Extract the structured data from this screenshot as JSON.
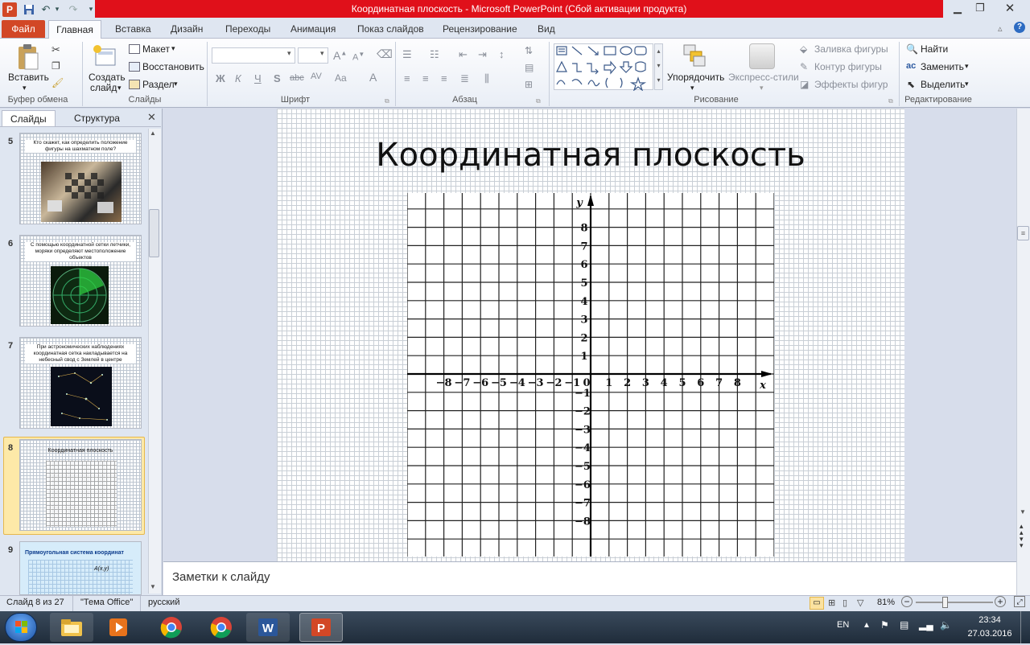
{
  "window": {
    "title": "Координатная плоскость  -  Microsoft PowerPoint (Сбой активации продукта)",
    "app_icon": "powerpoint-icon",
    "quick_access": [
      "save-icon",
      "undo-icon",
      "redo-icon",
      "customize-dropdown-icon"
    ]
  },
  "tabs": [
    "Файл",
    "Главная",
    "Вставка",
    "Дизайн",
    "Переходы",
    "Анимация",
    "Показ слайдов",
    "Рецензирование",
    "Вид"
  ],
  "ribbon": {
    "clipboard": {
      "label": "Буфер обмена",
      "paste": "Вставить"
    },
    "slides": {
      "label": "Слайды",
      "new_slide_line1": "Создать",
      "new_slide_line2": "слайд",
      "layout": "Макет",
      "reset": "Восстановить",
      "section": "Раздел"
    },
    "font": {
      "label": "Шрифт",
      "font_name": "",
      "font_size": "",
      "bold": "Ж",
      "italic": "К",
      "underline": "Ч",
      "shadow": "S",
      "strike": "abc",
      "spacing": "AV",
      "case": "Aa",
      "color": "A"
    },
    "paragraph": {
      "label": "Абзац"
    },
    "drawing": {
      "label": "Рисование",
      "arrange": "Упорядочить",
      "quick_styles": "Экспресс-стили",
      "fill": "Заливка фигуры",
      "outline": "Контур фигуры",
      "effects": "Эффекты фигур"
    },
    "editing": {
      "label": "Редактирование",
      "find": "Найти",
      "replace": "Заменить",
      "select": "Выделить"
    }
  },
  "panel": {
    "tab_slides": "Слайды",
    "tab_outline": "Структура",
    "thumbnails": [
      {
        "num": "5",
        "text": "Кто скажет, как определить положение фигуры на шахматном поле?"
      },
      {
        "num": "6",
        "text": "С помощью координатной сетки летчики, моряки определяют местоположение объектов"
      },
      {
        "num": "7",
        "text": "При астрономических наблюдениях координатная сетка накладывается на небесный свод с Землей в центре"
      },
      {
        "num": "8",
        "text": "Координатная плоскость"
      },
      {
        "num": "9",
        "text": "Прямоугольная система координат"
      }
    ],
    "thumb9_label": "A(x,y)"
  },
  "slide": {
    "title": "Координатная плоскость",
    "axis_x_label": "x",
    "axis_y_label": "y",
    "x_ticks": [
      "−8",
      "−7",
      "−6",
      "−5",
      "−4",
      "−3",
      "−2",
      "−1",
      "0",
      "1",
      "2",
      "3",
      "4",
      "5",
      "6",
      "7",
      "8"
    ],
    "y_ticks_pos": [
      "8",
      "7",
      "6",
      "5",
      "4",
      "3",
      "2",
      "1"
    ],
    "y_ticks_neg": [
      "−1",
      "−2",
      "−3",
      "−4",
      "−5",
      "−6",
      "−7",
      "−8"
    ]
  },
  "notes_placeholder": "Заметки к слайду",
  "status": {
    "slide_info": "Слайд 8 из 27",
    "theme": "\"Тема Office\"",
    "language": "русский",
    "zoom": "81%"
  },
  "taskbar": {
    "apps": [
      "start-button",
      "explorer-icon",
      "media-player-icon",
      "chrome-icon",
      "chrome-icon",
      "word-icon",
      "powerpoint-icon"
    ],
    "lang": "EN",
    "time": "23:34",
    "date": "27.03.2016"
  }
}
